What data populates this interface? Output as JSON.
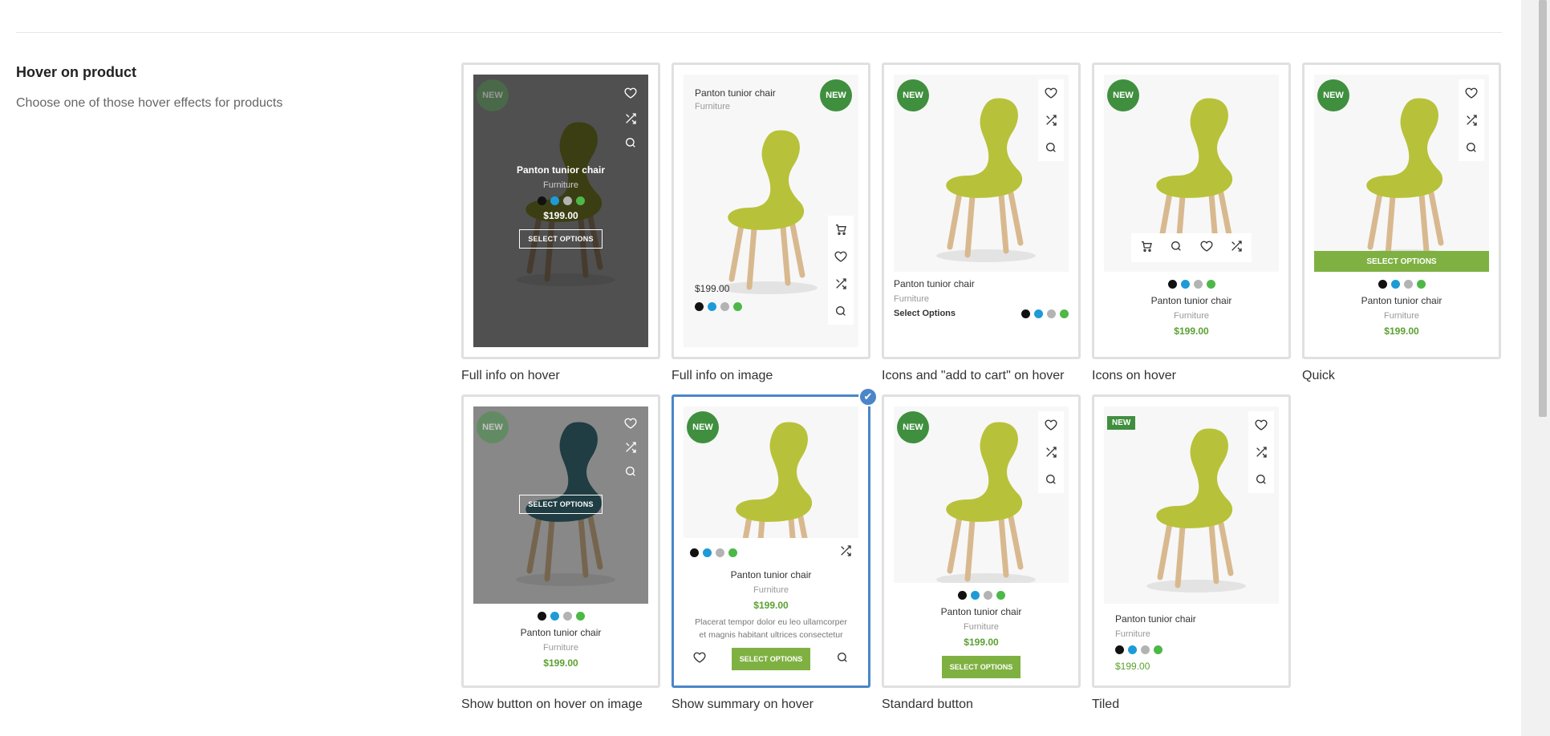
{
  "section": {
    "title": "Hover on product",
    "description": "Choose one of those hover effects for products"
  },
  "product": {
    "name": "Panton tunior chair",
    "category": "Furniture",
    "price": "$199.00",
    "badge": "NEW",
    "select_options": "SELECT OPTIONS",
    "select_options_link": "Select Options",
    "summary": "Placerat tempor dolor eu leo ullamcorper et magnis habitant ultrices consectetur",
    "swatches": [
      "#111111",
      "#1e9bd7",
      "#b3b3b3",
      "#4db848"
    ]
  },
  "options": [
    {
      "label": "Full info on hover"
    },
    {
      "label": "Full info on image"
    },
    {
      "label": "Icons and \"add to cart\" on hover"
    },
    {
      "label": "Icons on hover"
    },
    {
      "label": "Quick"
    },
    {
      "label": "Show button on hover on image"
    },
    {
      "label": "Show summary on hover",
      "selected": true
    },
    {
      "label": "Standard button"
    },
    {
      "label": "Tiled"
    }
  ],
  "colors": {
    "badge_green": "#3f8f3f",
    "price_green": "#5aa131",
    "button_green": "#7fb142",
    "selected_border": "#4a86c8",
    "chair_seat": "#b7c23a",
    "chair_legs": "#d8b98f"
  }
}
